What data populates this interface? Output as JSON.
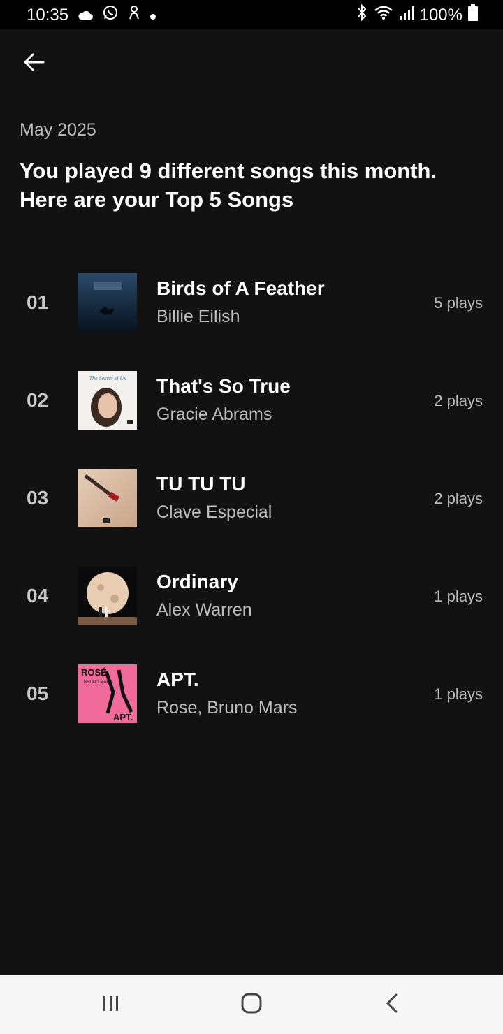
{
  "status_bar": {
    "time": "10:35",
    "battery": "100%",
    "left_icons": [
      "cloud-icon",
      "whatsapp-icon",
      "app-notification-icon",
      "dot-icon"
    ],
    "right_icons": [
      "bluetooth-icon",
      "wifi-icon",
      "signal-icon",
      "battery-icon"
    ]
  },
  "header": {
    "back_icon": "arrow-left-icon",
    "month": "May 2025",
    "headline_line1": "You played 9 different songs this month.",
    "headline_line2": "Here are your Top 5 Songs"
  },
  "songs": [
    {
      "rank": "01",
      "title": "Birds of A Feather",
      "artist": "Billie Eilish",
      "plays": "5 plays"
    },
    {
      "rank": "02",
      "title": "That's So True",
      "artist": "Gracie Abrams",
      "plays": "2 plays"
    },
    {
      "rank": "03",
      "title": "TU TU TU",
      "artist": "Clave Especial",
      "plays": "2 plays"
    },
    {
      "rank": "04",
      "title": "Ordinary",
      "artist": "Alex Warren",
      "plays": "1 plays"
    },
    {
      "rank": "05",
      "title": "APT.",
      "artist": "Rose, Bruno Mars",
      "plays": "1 plays"
    }
  ],
  "art_text": {
    "gracie": "The Secret of Us",
    "rose_1": "ROSÉ",
    "rose_2": "BRUNO MARS",
    "rose_3": "APT."
  },
  "nav_bar": [
    "recent-apps-icon",
    "home-icon",
    "back-chevron-icon"
  ],
  "colors": {
    "background": "#121212",
    "text": "#ffffff",
    "secondary": "#bdbdbd",
    "navbar": "#f6f6f6"
  }
}
